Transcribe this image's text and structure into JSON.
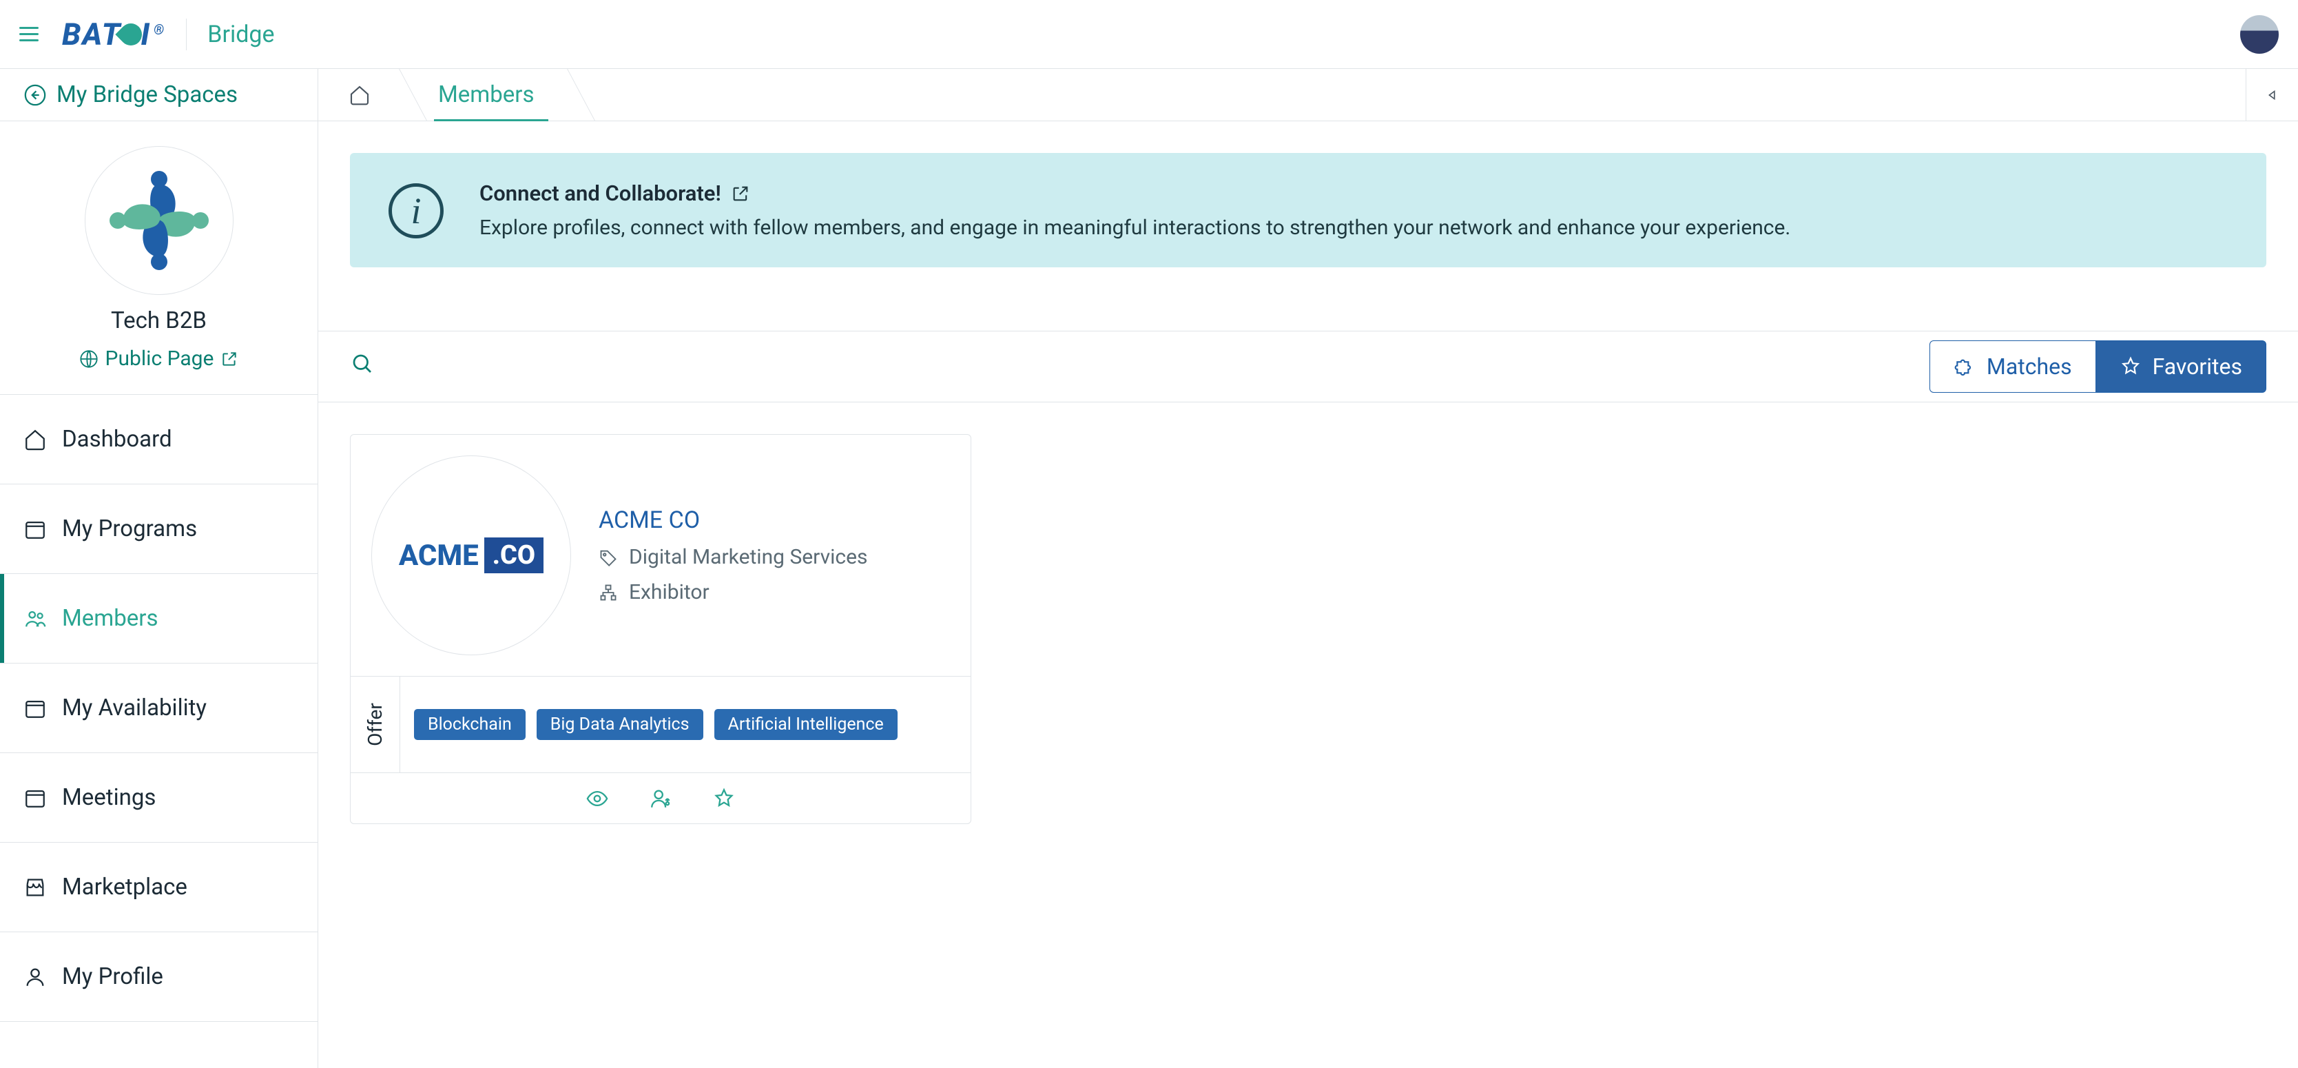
{
  "header": {
    "brand": "BATOI",
    "app": "Bridge"
  },
  "workspace": {
    "back_label": "My Bridge Spaces",
    "name": "Tech B2B",
    "public_link": "Public Page"
  },
  "sidebar": {
    "items": [
      {
        "key": "dashboard",
        "label": "Dashboard"
      },
      {
        "key": "my-programs",
        "label": "My Programs"
      },
      {
        "key": "members",
        "label": "Members"
      },
      {
        "key": "my-availability",
        "label": "My Availability"
      },
      {
        "key": "meetings",
        "label": "Meetings"
      },
      {
        "key": "marketplace",
        "label": "Marketplace"
      },
      {
        "key": "my-profile",
        "label": "My Profile"
      }
    ]
  },
  "breadcrumb": {
    "current": "Members"
  },
  "info": {
    "title": "Connect and Collaborate!",
    "desc": "Explore profiles, connect with fellow members, and engage in meaningful interactions to strengthen your network and enhance your experience."
  },
  "toolbar": {
    "matches_label": "Matches",
    "favorites_label": "Favorites"
  },
  "member_card": {
    "name": "ACME CO",
    "logo_main": "ACME",
    "logo_box": ".CO",
    "category": "Digital Marketing Services",
    "role": "Exhibitor",
    "offer_label": "Offer",
    "tags": [
      "Blockchain",
      "Big Data Analytics",
      "Artificial Intelligence"
    ]
  }
}
